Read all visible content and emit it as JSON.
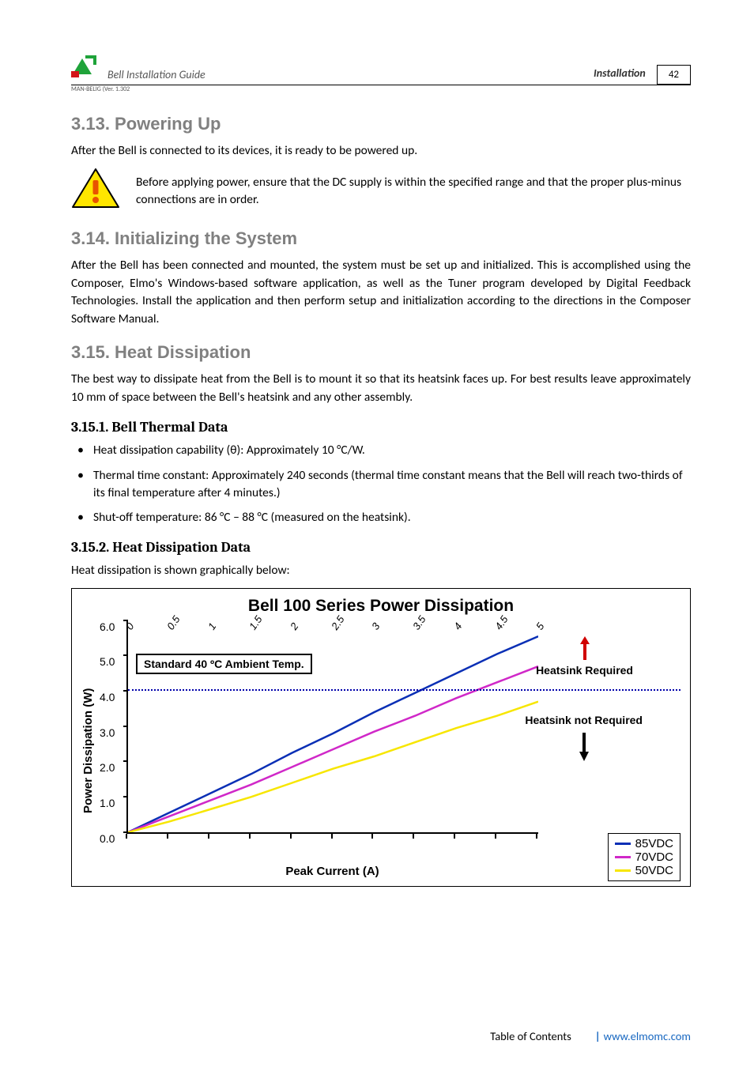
{
  "header": {
    "guide_title": "Bell Installation Guide",
    "section": "Installation",
    "doc_id": "MAN-BELIG (Ver. 1.302",
    "page_number": "42"
  },
  "sections": {
    "s313": {
      "heading": "3.13.  Powering Up",
      "p1": "After the Bell is connected to its devices, it is ready to be powered up.",
      "warn": "Before applying power, ensure that the DC supply is within the specified range and that the proper plus-minus connections are in order."
    },
    "s314": {
      "heading": "3.14.  Initializing the System",
      "p1": "After the Bell has been connected and mounted, the system must be set up and initialized. This is accomplished using the Composer, Elmo's Windows-based software application, as well as the Tuner program developed by Digital Feedback Technologies. Install the application and then perform setup and initialization according to the directions in the Composer Software Manual."
    },
    "s315": {
      "heading": "3.15.  Heat Dissipation",
      "p1": "The best way to dissipate heat from the Bell is to mount it so that its heatsink faces up. For best results leave approximately 10 mm of space between the Bell's heatsink and any other assembly."
    },
    "s3151": {
      "heading": "3.15.1.     Bell Thermal Data",
      "b1": "Heat dissipation capability (θ): Approximately 10 °C/W.",
      "b2": "Thermal time constant: Approximately 240 seconds (thermal time constant means that the Bell will reach two-thirds of its final temperature after 4 minutes.)",
      "b3": "Shut-off temperature: 86 °C – 88 °C (measured on the heatsink)."
    },
    "s3152": {
      "heading": "3.15.2.     Heat Dissipation Data",
      "p1": "Heat dissipation is shown graphically below:"
    }
  },
  "chart_data": {
    "type": "line",
    "title": "Bell 100 Series Power Dissipation",
    "xlabel": "Peak Current (A)",
    "ylabel": "Power Dissipation (W)",
    "x": [
      0,
      0.5,
      1,
      1.5,
      2,
      2.5,
      3,
      3.5,
      4,
      4.5,
      5
    ],
    "ylim": [
      0.0,
      6.0
    ],
    "yticks": [
      "0.0",
      "1.0",
      "2.0",
      "3.0",
      "4.0",
      "5.0",
      "6.0"
    ],
    "xticks": [
      "0",
      "0.5",
      "1",
      "1.5",
      "2",
      "2.5",
      "3",
      "3.5",
      "4",
      "4.5",
      "5"
    ],
    "series": [
      {
        "name": "85VDC",
        "color": "#0a2fb5",
        "values": [
          0.0,
          0.55,
          1.1,
          1.65,
          2.25,
          2.8,
          3.4,
          3.95,
          4.5,
          5.05,
          5.55
        ]
      },
      {
        "name": "70VDC",
        "color": "#d028c8",
        "values": [
          0.0,
          0.45,
          0.9,
          1.35,
          1.85,
          2.35,
          2.85,
          3.3,
          3.8,
          4.25,
          4.7
        ]
      },
      {
        "name": "50VDC",
        "color": "#f7e600",
        "values": [
          0.0,
          0.3,
          0.65,
          1.0,
          1.4,
          1.8,
          2.15,
          2.55,
          2.95,
          3.3,
          3.7
        ]
      }
    ],
    "annotations": {
      "standard_temp": "Standard 40 ºC Ambient Temp.",
      "hs_required": "Heatsink Required",
      "hs_not_required": "Heatsink not Required",
      "threshold_value": 4.0
    }
  },
  "footer": {
    "toc": "Table of Contents",
    "url": "www.elmomc.com"
  }
}
